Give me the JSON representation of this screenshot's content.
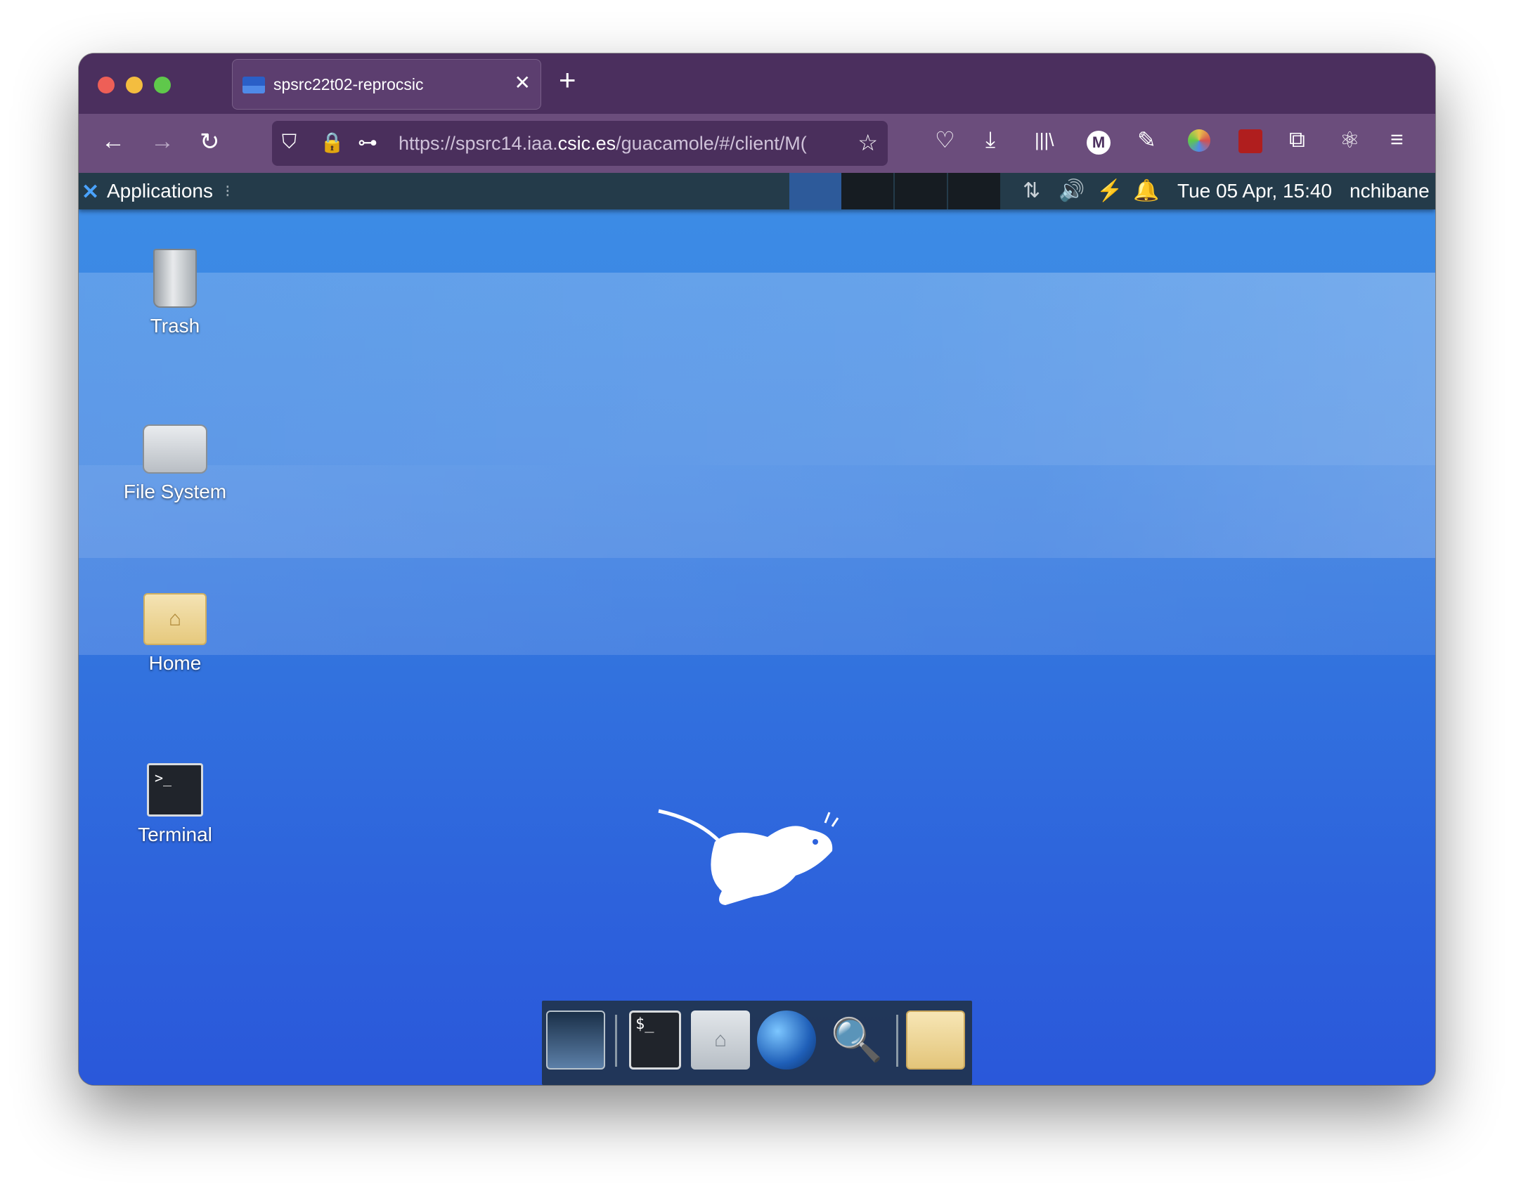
{
  "browser": {
    "tab": {
      "title": "spsrc22t02-reprocsic",
      "close_glyph": "✕"
    },
    "new_tab_glyph": "+",
    "nav": {
      "back_glyph": "←",
      "forward_glyph": "→",
      "reload_glyph": "↻"
    },
    "url": {
      "prefix": "https://spsrc14.iaa.",
      "domain": "csic.es",
      "path": "/guacamole/#/client/M("
    },
    "toolbar_icons": [
      "pocket-icon",
      "download-icon",
      "library-icon",
      "m-extension-icon",
      "pencil-icon",
      "palette-icon",
      "extension-icon",
      "open-external-icon",
      "react-devtools-icon",
      "menu-icon"
    ],
    "toolbar_glyphs": {
      "pocket": "♡",
      "download": "⤓",
      "library": "|||\\",
      "m_ext": "M",
      "pencil": "✎",
      "open_external": "⧉",
      "atom": "⚛",
      "menu": "≡",
      "star": "☆",
      "shield": "⛉",
      "lock": "🔒",
      "perm": "⊶"
    }
  },
  "xfce": {
    "panel": {
      "apps_logo": "✕",
      "apps_label": "Applications",
      "apps_handle": "⁝",
      "tray_glyphs": {
        "network": "⇅",
        "volume": "🔊",
        "power": "⚡",
        "bell": "🔔"
      },
      "clock": "Tue 05 Apr, 15:40",
      "user": "nchibane"
    },
    "desktop_icons": {
      "trash": "Trash",
      "filesystem": "File System",
      "home": "Home",
      "terminal": "Terminal"
    },
    "glyphs": {
      "home_house": "⌂",
      "terminal_prompt": ">_",
      "dock_terminal": "$_",
      "dock_search": "🔍"
    }
  },
  "colors": {
    "browser_chrome": "#4b2f5e",
    "panel": "#243b4a",
    "desktop_blue": "#3272de"
  }
}
